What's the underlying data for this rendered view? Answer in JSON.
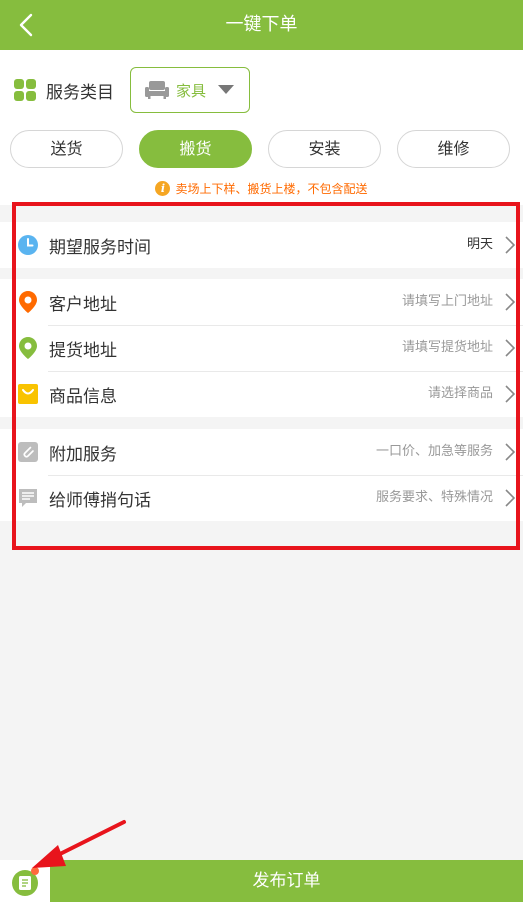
{
  "header": {
    "title": "一键下单"
  },
  "category": {
    "label": "服务类目",
    "selected": "家具"
  },
  "tabs": [
    {
      "label": "送货",
      "active": false
    },
    {
      "label": "搬货",
      "active": true
    },
    {
      "label": "安装",
      "active": false
    },
    {
      "label": "维修",
      "active": false
    }
  ],
  "notice": "卖场上下样、搬货上楼，不包含配送",
  "groups": [
    [
      {
        "label": "期望服务时间",
        "value": "明天",
        "icon": "clock-icon"
      }
    ],
    [
      {
        "label": "客户地址",
        "value": "请填写上门地址",
        "icon": "location-pin-icon"
      },
      {
        "label": "提货地址",
        "value": "请填写提货地址",
        "icon": "location-pin-icon"
      },
      {
        "label": "商品信息",
        "value": "请选择商品",
        "icon": "shopping-bag-icon"
      }
    ],
    [
      {
        "label": "附加服务",
        "value": "一口价、加急等服务",
        "icon": "paperclip-icon"
      },
      {
        "label": "给师傅捎句话",
        "value": "服务要求、特殊情况",
        "icon": "message-icon"
      }
    ]
  ],
  "bottom": {
    "publish_label": "发布订单"
  },
  "colors": {
    "brand": "#86bd3e",
    "notice": "#ff6a00",
    "highlight": "#e8141c",
    "clock": "#5ab4f0",
    "pin_customer": "#ff6a00",
    "pin_pickup": "#86bd3e",
    "bag": "#f9c300",
    "gray_icon": "#bdbdbd"
  }
}
